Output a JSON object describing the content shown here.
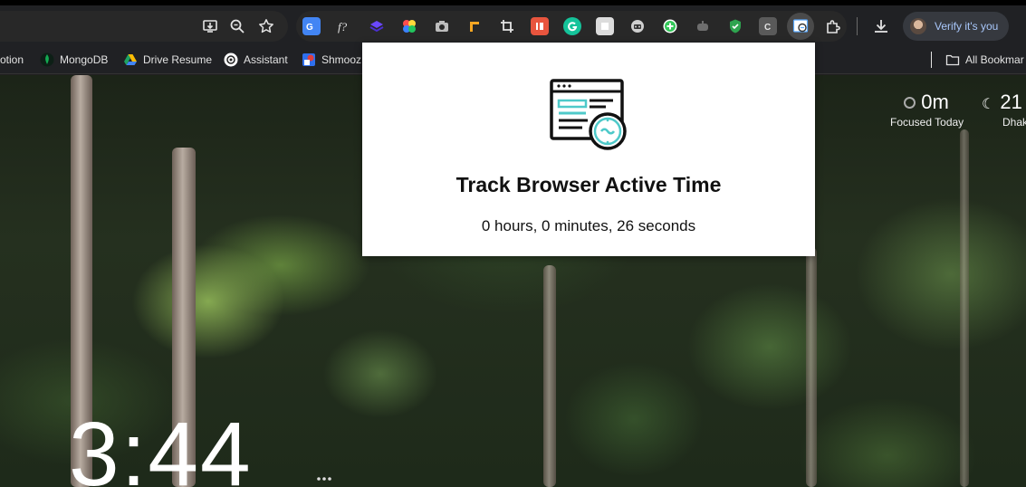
{
  "toolbar": {
    "omnibox_icons": [
      "install-app-icon",
      "zoom-icon",
      "bookmark-star-icon"
    ],
    "extensions": [
      {
        "name": "google-translate-icon",
        "color": "#4285f4"
      },
      {
        "name": "formula-icon",
        "color": "#e3e3e3"
      },
      {
        "name": "stack-icon",
        "color": "#6b48ff"
      },
      {
        "name": "color-wheel-icon",
        "color": "#ff5a5a"
      },
      {
        "name": "camera-icon",
        "color": "#bdbdbd"
      },
      {
        "name": "ruler-icon",
        "color": "#f5a623"
      },
      {
        "name": "crop-icon",
        "color": "#e3e3e3"
      },
      {
        "name": "red-square-icon",
        "color": "#e8553e"
      },
      {
        "name": "grammarly-icon",
        "color": "#15c39a"
      },
      {
        "name": "note-icon",
        "color": "#dcdcdc"
      },
      {
        "name": "robot-icon",
        "color": "#cfcfcf"
      },
      {
        "name": "plus-circle-icon",
        "color": "#34c759"
      },
      {
        "name": "gray-robot-icon",
        "color": "#6e6e6e"
      },
      {
        "name": "shield-icon",
        "color": "#2ea44f"
      },
      {
        "name": "c-icon",
        "color": "#9e9e9e"
      },
      {
        "name": "active-time-tracker-icon",
        "color": "#5aa9ff"
      },
      {
        "name": "extensions-puzzle-icon",
        "color": "#e3e3e3"
      }
    ],
    "verify_label": "Verify it's you"
  },
  "bookmarks": {
    "items": [
      {
        "label": "otion",
        "icon": "notion-icon"
      },
      {
        "label": "MongoDB",
        "icon": "mongodb-icon"
      },
      {
        "label": "Drive Resume",
        "icon": "google-drive-icon"
      },
      {
        "label": "Assistant",
        "icon": "openai-icon"
      },
      {
        "label": "Shmooz",
        "icon": "shmooz-icon"
      }
    ],
    "all_bookmarks": "All Bookmar"
  },
  "widgets": {
    "focus_value": "0m",
    "focus_caption": "Focused Today",
    "weather_value": "21",
    "weather_caption": "Dhak",
    "clock": "3:44"
  },
  "popup": {
    "title": "Track Browser Active Time",
    "elapsed": "0 hours, 0 minutes, 26 seconds"
  }
}
